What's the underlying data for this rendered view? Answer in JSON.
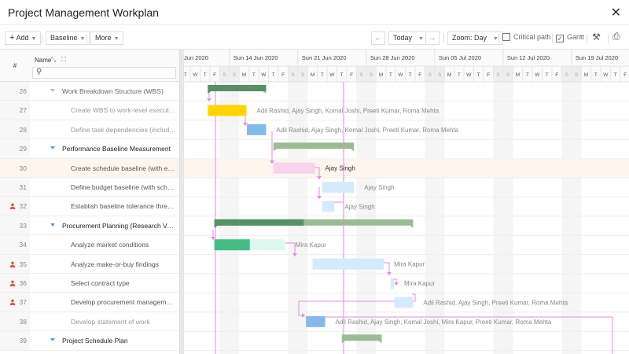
{
  "window": {
    "title": "Project Management Workplan",
    "close_icon": "close-icon"
  },
  "toolbar": {
    "add": "Add",
    "baseline": "Baseline",
    "more": "More",
    "today": "Today",
    "zoom": "Zoom: Day",
    "critical_path": "Critical path",
    "critical_path_checked": false,
    "gantt": "Gantt",
    "gantt_checked": true
  },
  "grid": {
    "col_num": "#",
    "col_name": "Name",
    "search_placeholder": ""
  },
  "timeline": {
    "weeks": [
      "Jun 2020",
      "Sun 14 Jun 2020",
      "Sun 21 Jun 2020",
      "Sun 28 Jun 2020",
      "Sun 05 Jul 2020",
      "Sun 12 Jul 2020",
      "Sun 19 Jul 2020"
    ],
    "day_letters": [
      "S",
      "M",
      "T",
      "W",
      "T",
      "F",
      "S"
    ],
    "first_visible_day": "2020-06-09"
  },
  "colors": {
    "summary_done": "#568f68",
    "summary": "#9dba96",
    "highlight_row": "#fff5ef",
    "dependency": "#e08ee0",
    "weekend": "#f5f5f5"
  },
  "rows": [
    {
      "id": "26",
      "name": "Work Breakdown Structure (WBS)",
      "type": "summary",
      "muted": true,
      "start": "2020-06-11T19:00",
      "end": "2020-06-17T18:00",
      "progress": 1
    },
    {
      "id": "27",
      "name": "Create WBS to work-level execution",
      "type": "task",
      "muted": true,
      "strip": "#ffd966",
      "color": "#ffd400",
      "start": "2020-06-11T19:00",
      "end": "2020-06-15T18:00",
      "resources": "Adil Rashid, Ajay Singh, Komal Joshi, Preeti Kumar, Roma Mehta"
    },
    {
      "id": "28",
      "name": "Define task dependencies (includin...",
      "type": "task",
      "muted": true,
      "color": "#84b9ea",
      "start": "2020-06-15T19:00",
      "end": "2020-06-17T18:00",
      "resources": "Adil Rashid, Ajay Singh, Komal Joshi, Preeti Kumar, Roma Mehta"
    },
    {
      "id": "29",
      "name": "Performance Baseline Measurement",
      "type": "summary",
      "start": "2020-06-18T12:00",
      "end": "2020-06-26T18:00",
      "progress": 0
    },
    {
      "id": "30",
      "name": "Create schedule baseline (with exp...",
      "type": "task",
      "selected": true,
      "strip": "#f7a8e0",
      "color": "#f9d3ec",
      "start": "2020-06-18T12:00",
      "end": "2020-06-22T18:00",
      "resources": "Ajay Singh"
    },
    {
      "id": "31",
      "name": "Define budget baseline (with sched...",
      "type": "task",
      "color": "#d5eafc",
      "start": "2020-06-23T12:00",
      "end": "2020-06-26T18:00",
      "resources": "Ajay Singh"
    },
    {
      "id": "32",
      "name": "Establish baseline tolerance thresh...",
      "type": "task",
      "person": true,
      "color": "#d5eafc",
      "start": "2020-06-23T12:00",
      "end": "2020-06-24T18:00",
      "resources": "Ajay Singh"
    },
    {
      "id": "33",
      "name": "Procurement Planning (Research Ven...",
      "type": "summary",
      "start": "2020-06-12T11:00",
      "end": "2020-07-02T19:00",
      "progress": 0.45
    },
    {
      "id": "34",
      "name": "Analyze market conditions",
      "type": "task",
      "strip": "#b4e3b0",
      "color": "#dff8ee",
      "done_color": "#44bd85",
      "progress": 0.5,
      "start": "2020-06-12T11:00",
      "end": "2020-06-19T17:00",
      "resources": "Mira Kapur"
    },
    {
      "id": "35",
      "name": "Analyze make-or-buy findings",
      "type": "task",
      "person": true,
      "color": "#d5eafc",
      "start": "2020-06-22T12:00",
      "end": "2020-06-29T19:00",
      "resources": "Mira Kapur"
    },
    {
      "id": "36",
      "name": "Select contract type",
      "type": "task",
      "person": true,
      "color": "#d5eafc",
      "start": "2020-06-30T12:00",
      "end": "2020-06-30T20:00",
      "resources": "Mira Kapur"
    },
    {
      "id": "37",
      "name": "Develop procurement management...",
      "type": "task",
      "person": true,
      "color": "#d5eafc",
      "start": "2020-06-30T21:00",
      "end": "2020-07-02T19:00",
      "resources": "Adil Rashid, Ajay Singh, Preeti Kumar, Roma Mehta"
    },
    {
      "id": "38",
      "name": "Develop statement of work",
      "type": "task",
      "muted": true,
      "color": "#84b9ea",
      "start": "2020-06-21T20:00",
      "end": "2020-06-23T19:00",
      "resources": "Adil Rashid, Ajay Singh, Komal Joshi, Mira Kapur, Preeti Kumar, Roma Mehta"
    },
    {
      "id": "39",
      "name": "Project Schedule Plan",
      "type": "summary",
      "start": "2020-06-25T12:00",
      "end": "2020-06-29T14:00",
      "progress": 0
    }
  ]
}
